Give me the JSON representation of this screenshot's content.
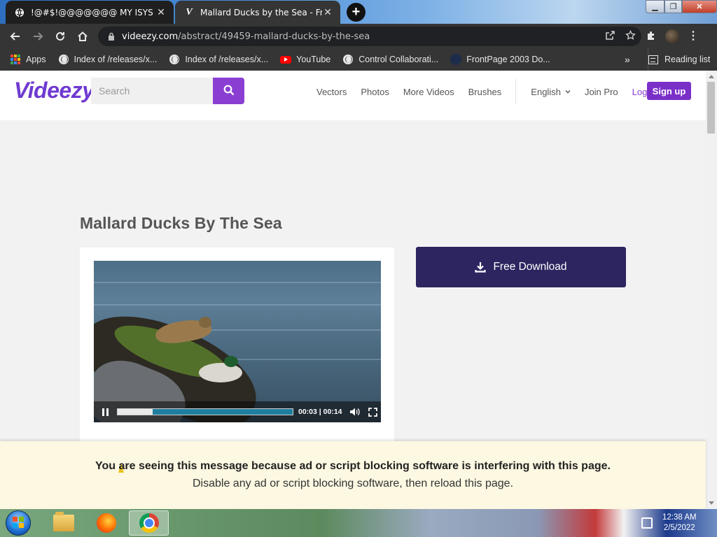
{
  "browser": {
    "tabs": [
      {
        "title": "!@#$!@@@@@@@ MY ISYS PROFILE",
        "active": true
      },
      {
        "title": "Mallard Ducks by the Sea - Free Stock Video",
        "active": false
      }
    ],
    "url_domain": "videezy.com",
    "url_path": "/abstract/49459-mallard-ducks-by-the-sea",
    "bookmarks": [
      {
        "label": "Apps",
        "icon": "apps-grid-icon"
      },
      {
        "label": "Index of /releases/x...",
        "icon": "globe-icon"
      },
      {
        "label": "Index of /releases/x...",
        "icon": "globe-icon"
      },
      {
        "label": "YouTube",
        "icon": "youtube-icon"
      },
      {
        "label": "Control Collaborati...",
        "icon": "globe-icon"
      },
      {
        "label": "FrontPage 2003 Do...",
        "icon": "frontpage-icon"
      }
    ],
    "bookmarks_more": "»",
    "reading_list": "Reading list"
  },
  "site": {
    "logo": "Videezy",
    "search_placeholder": "Search",
    "nav": {
      "vectors": "Vectors",
      "photos": "Photos",
      "more_videos": "More Videos",
      "brushes": "Brushes",
      "language": "English",
      "join_pro": "Join Pro",
      "login": "Log in",
      "signup": "Sign up"
    },
    "page_title": "Mallard Ducks By The Sea",
    "video": {
      "current_time": "00:03",
      "duration": "00:14",
      "progress_fraction": 0.2
    },
    "download_button": "Free Download"
  },
  "adblock_banner": {
    "line1": "You are seeing this message because ad or script blocking software is interfering with this page.",
    "line2": "Disable any ad or script blocking software, then reload this page."
  },
  "taskbar": {
    "time": "12:38 AM",
    "date": "2/5/2022"
  },
  "colors": {
    "brand_purple": "#8b3fd2",
    "download_navy": "#2c2560",
    "banner_bg": "#fdf8e2"
  }
}
